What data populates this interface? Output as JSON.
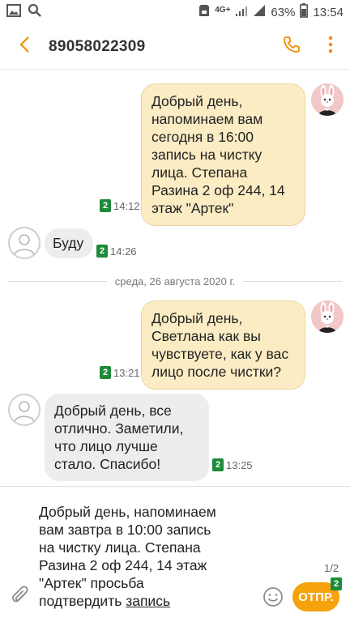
{
  "status_bar": {
    "network": "4G+",
    "battery_percent": "63%",
    "time": "13:54"
  },
  "header": {
    "contact": "89058022309"
  },
  "conversation": {
    "messages": [
      {
        "direction": "outgoing",
        "lines": [
          "Добрый день,",
          "напоминаем вам",
          "сегодня в 16:00",
          "запись на чистку",
          "лица. Степана",
          "Разина 2 оф 244, 14",
          "этаж \"Артек\""
        ],
        "sim": "2",
        "time": "14:12"
      },
      {
        "direction": "incoming",
        "lines": [
          "Буду"
        ],
        "sim": "2",
        "time": "14:26"
      },
      {
        "direction": "outgoing",
        "lines": [
          "Добрый день,",
          "Светлана как вы",
          "чувствуете, как у вас",
          "лицо после чистки?"
        ],
        "sim": "2",
        "time": "13:21"
      },
      {
        "direction": "incoming",
        "lines": [
          "Добрый день, все",
          "отлично. Заметили,",
          "что лицо лучше",
          "стало. Спасибо!"
        ],
        "sim": "2",
        "time": "13:25"
      }
    ],
    "date_separator": "среда, 26 августа 2020 г."
  },
  "composer": {
    "lines": [
      "Добрый день, напоминаем",
      "вам завтра в 10:00 запись",
      "на чистку лица. Степана",
      "Разина 2 оф 244, 14 этаж",
      "\"Артек\" просьба"
    ],
    "last_line_plain": "подтвердить ",
    "last_line_underlined": "запись",
    "page_count": "1/2",
    "send_label": "ОТПР.",
    "send_sim": "2"
  },
  "colors": {
    "accent": "#f5a20c",
    "outgoing_bubble": "#fbecc4",
    "incoming_bubble": "#ededed",
    "sim_badge": "#1f8a3a"
  },
  "icons": {
    "status_left": [
      "image-icon",
      "search-icon"
    ],
    "status_right": [
      "sd-card-icon",
      "wifi-icon",
      "signal-icon",
      "battery-icon"
    ],
    "header": [
      "back-arrow-icon",
      "phone-icon",
      "more-vert-icon"
    ],
    "composer": [
      "attach-icon",
      "emoji-icon"
    ]
  }
}
